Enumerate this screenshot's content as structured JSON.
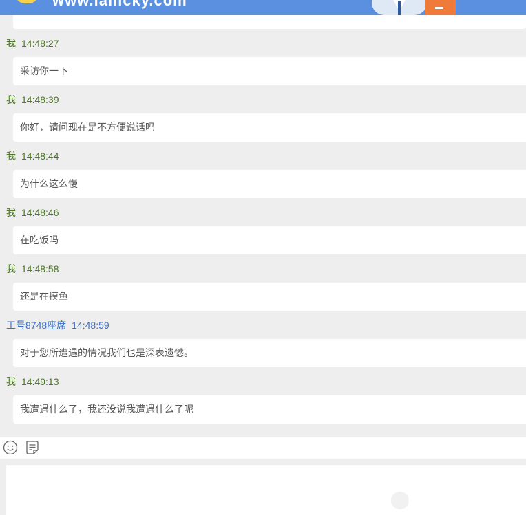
{
  "header": {
    "site_name": "www.lailicky.com",
    "colors": {
      "bar": "#5b8fe0",
      "minimize_button": "#f07a3a"
    }
  },
  "chat": {
    "messages": [
      {
        "sender": "我",
        "time": "14:48:27",
        "text": "采访你一下",
        "role": "me"
      },
      {
        "sender": "我",
        "time": "14:48:39",
        "text": "你好，请问现在是不方便说话吗",
        "role": "me"
      },
      {
        "sender": "我",
        "time": "14:48:44",
        "text": "为什么这么慢",
        "role": "me"
      },
      {
        "sender": "我",
        "time": "14:48:46",
        "text": "在吃饭吗",
        "role": "me"
      },
      {
        "sender": "我",
        "time": "14:48:58",
        "text": "还是在摸鱼",
        "role": "me"
      },
      {
        "sender": "工号8748座席",
        "time": "14:48:59",
        "text": "对于您所遭遇的情况我们也是深表遗憾。",
        "role": "agent"
      },
      {
        "sender": "我",
        "time": "14:49:13",
        "text": "我遭遇什么了，我还没说我遭遇什么了呢",
        "role": "me"
      }
    ],
    "colors": {
      "me_name": "#4a7a1e",
      "agent_name": "#3a6fc4",
      "log_background": "#eeeeee"
    }
  },
  "toolbar": {
    "icons": [
      "smiley-icon",
      "notes-icon"
    ]
  },
  "composer": {
    "value": "",
    "placeholder": ""
  }
}
